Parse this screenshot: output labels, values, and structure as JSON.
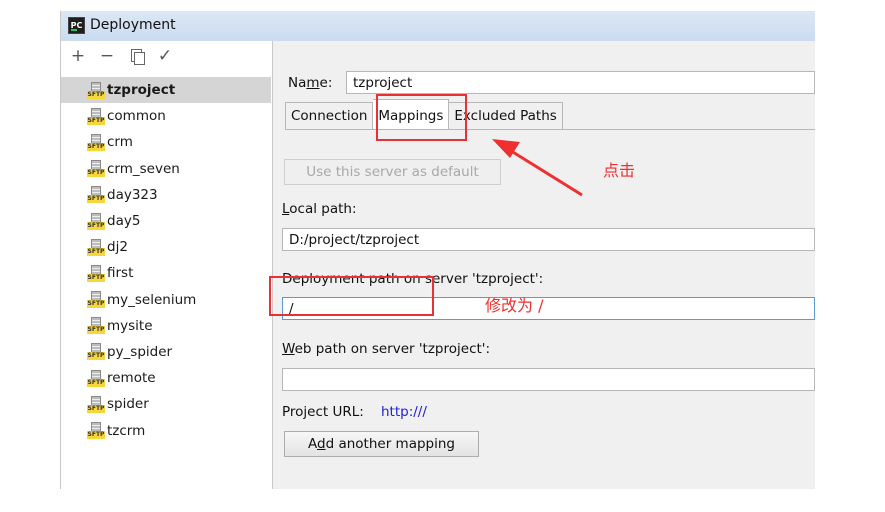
{
  "window": {
    "title": "Deployment",
    "app_icon_text": "PC"
  },
  "toolbar": {
    "add": "+",
    "remove": "−",
    "check": "✓"
  },
  "servers": [
    {
      "name": "tzproject",
      "selected": true
    },
    {
      "name": "common"
    },
    {
      "name": "crm"
    },
    {
      "name": "crm_seven"
    },
    {
      "name": "day323"
    },
    {
      "name": "day5"
    },
    {
      "name": "dj2"
    },
    {
      "name": "first"
    },
    {
      "name": "my_selenium"
    },
    {
      "name": "mysite"
    },
    {
      "name": "py_spider"
    },
    {
      "name": "remote"
    },
    {
      "name": "spider"
    },
    {
      "name": "tzcrm"
    }
  ],
  "sftp_label": "SFTP",
  "form": {
    "name_label_pre": "Na",
    "name_label_mn": "m",
    "name_label_post": "e:",
    "name_value": "tzproject",
    "tabs": [
      "Connection",
      "Mappings",
      "Excluded Paths"
    ],
    "active_tab": "Mappings",
    "default_button": "Use this server as default",
    "local_path_label_l": "L",
    "local_path_label_rest": "ocal path:",
    "local_path_value": "D:/project/tzproject",
    "deploy_path_label": "Deployment path on server 'tzproject':",
    "deploy_path_value": "/",
    "web_path_label_w": "W",
    "web_path_label_rest": "eb path on server 'tzproject':",
    "web_path_value": "",
    "project_url_label": "Project URL:",
    "project_url_value": "http:///",
    "add_mapping_pre": "A",
    "add_mapping_mn": "d",
    "add_mapping_post": "d another mapping"
  },
  "annotations": {
    "click_note": "点击",
    "change_note": "修改为  /",
    "color": "#e53232"
  }
}
